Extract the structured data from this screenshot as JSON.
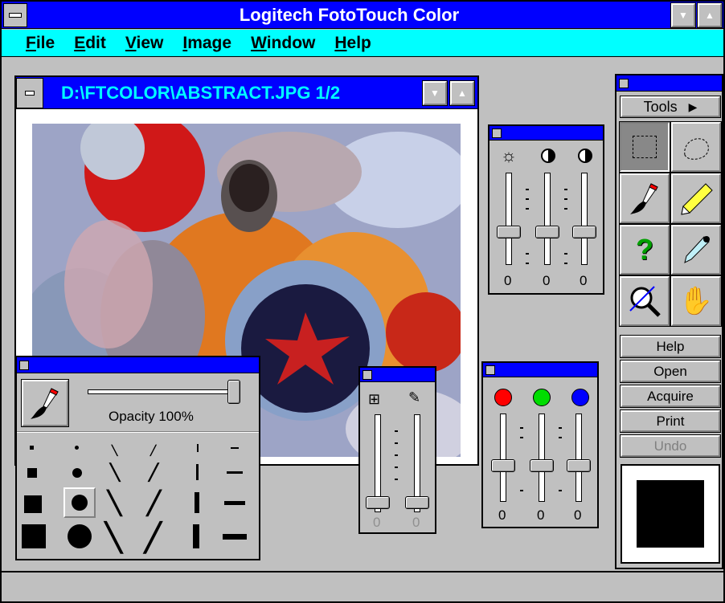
{
  "app": {
    "title": "Logitech FotoTouch Color"
  },
  "menu": [
    {
      "label": "File",
      "accel": "F",
      "rest": "ile"
    },
    {
      "label": "Edit",
      "accel": "E",
      "rest": "dit"
    },
    {
      "label": "View",
      "accel": "V",
      "rest": "iew"
    },
    {
      "label": "Image",
      "accel": "I",
      "rest": "mage"
    },
    {
      "label": "Window",
      "accel": "W",
      "rest": "indow"
    },
    {
      "label": "Help",
      "accel": "H",
      "rest": "elp"
    }
  ],
  "document": {
    "title": "D:\\FTCOLOR\\ABSTRACT.JPG 1/2"
  },
  "brightness_panel": {
    "values": [
      "0",
      "0",
      "0"
    ]
  },
  "rgb_panel": {
    "values": [
      "0",
      "0",
      "0"
    ],
    "colors": [
      "#ff0000",
      "#00dd00",
      "#0000ff"
    ]
  },
  "mask_panel": {
    "values": [
      "0",
      "0"
    ]
  },
  "brush_panel": {
    "opacity_label": "Opacity 100%",
    "opacity": 1.0
  },
  "toolbox": {
    "header": "Tools",
    "tools": [
      "rectangle-select",
      "lasso-select",
      "paintbrush",
      "pencil",
      "help",
      "eyedropper",
      "zoom",
      "hand"
    ],
    "buttons": [
      "Help",
      "Open",
      "Acquire",
      "Print",
      "Undo"
    ],
    "current_color": "#000000"
  }
}
